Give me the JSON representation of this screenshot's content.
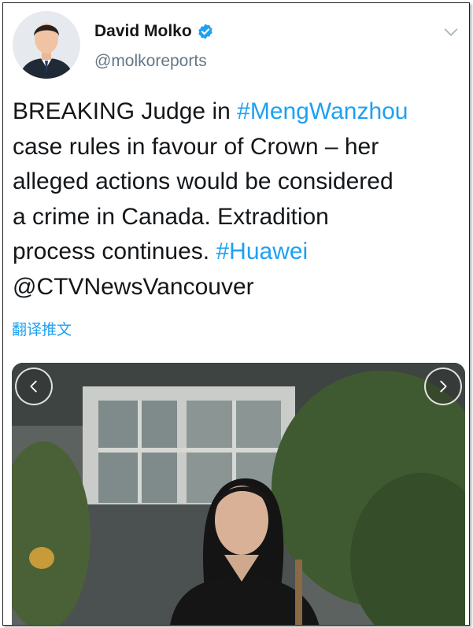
{
  "author": {
    "name": "David Molko",
    "handle": "@molkoreports",
    "verified": true
  },
  "tweet": {
    "line1_pre": "BREAKING Judge in ",
    "line1_tag": "#MengWanzhou",
    "line2": "case rules in favour of Crown – her",
    "line3": "alleged actions would be considered",
    "line4": "a crime in Canada.  Extradition",
    "line5_pre": "process continues.  ",
    "line5_tag": "#Huawei",
    "line6": "@CTVNewsVancouver"
  },
  "translate_label": "翻译推文",
  "colors": {
    "link": "#1da1f2",
    "text": "#14171a",
    "secondary": "#657786"
  },
  "icons": {
    "verified": "verified-badge-icon",
    "menu": "chevron-down-icon",
    "prev": "chevron-left-icon",
    "next": "chevron-right-icon"
  }
}
